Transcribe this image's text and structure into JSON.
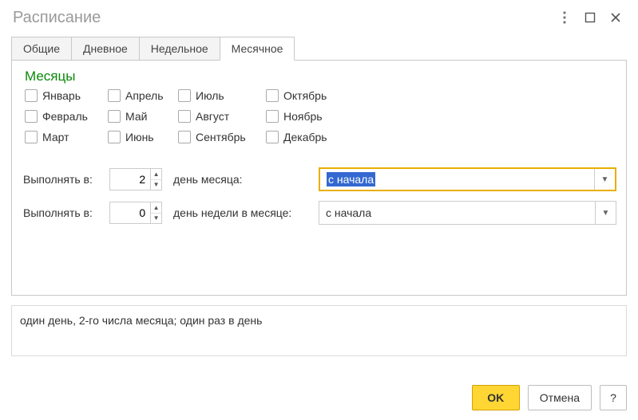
{
  "window": {
    "title": "Расписание"
  },
  "tabs": {
    "items": [
      {
        "label": "Общие"
      },
      {
        "label": "Дневное"
      },
      {
        "label": "Недельное"
      },
      {
        "label": "Месячное"
      }
    ],
    "active": 3
  },
  "months_section": {
    "title": "Месяцы",
    "items": [
      "Январь",
      "Апрель",
      "Июль",
      "Октябрь",
      "Февраль",
      "Май",
      "Август",
      "Ноябрь",
      "Март",
      "Июнь",
      "Сентябрь",
      "Декабрь"
    ]
  },
  "exec_rows": {
    "dom_label": "Выполнять в:",
    "dom_value": "2",
    "dom_unit": "день месяца:",
    "dom_origin": "с начала",
    "dow_label": "Выполнять в:",
    "dow_value": "0",
    "dow_unit": "день недели в месяце:",
    "dow_origin": "с начала"
  },
  "summary": "один день, 2-го числа месяца; один раз в день",
  "footer": {
    "ok": "OK",
    "cancel": "Отмена",
    "help": "?"
  }
}
